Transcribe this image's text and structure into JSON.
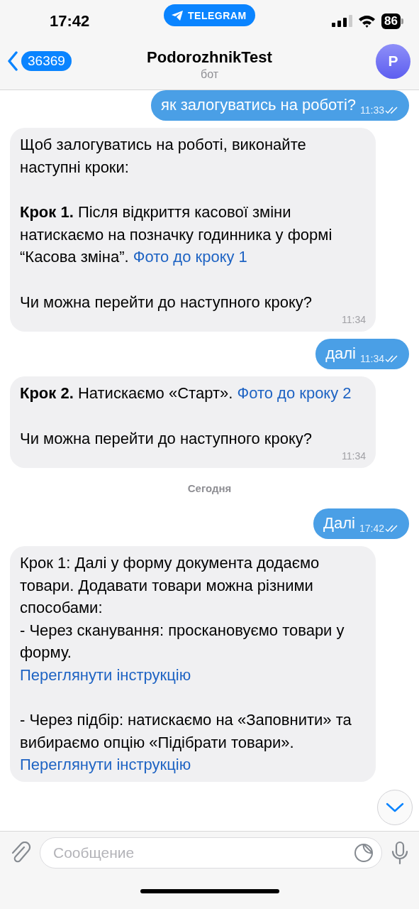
{
  "status_bar": {
    "time": "17:42",
    "app_pill": "TELEGRAM",
    "battery": "86"
  },
  "header": {
    "back_count": "36369",
    "title": "PodorozhnikTest",
    "subtitle": "бот",
    "avatar_letter": "P"
  },
  "messages": [
    {
      "kind": "outgoing",
      "text": "як залогуватись на роботі?",
      "time": "11:33",
      "read": true
    },
    {
      "kind": "incoming",
      "paragraphs": [
        {
          "text": "Щоб залогуватись на роботі, виконайте наступні кроки:"
        },
        {
          "text": "**Крок 1.** Після відкриття касової зміни натискаємо на позначку годинника у формі “Касова зміна”.",
          "link": "Фото до кроку 1"
        },
        {
          "text": "Чи можна перейти до наступного кроку?"
        }
      ],
      "time": "11:34"
    },
    {
      "kind": "outgoing",
      "text": "далі",
      "time": "11:34",
      "read": true
    },
    {
      "kind": "incoming",
      "paragraphs": [
        {
          "text": "**Крок 2.** Натискаємо «Старт».",
          "link": "Фото до кроку 2"
        },
        {
          "text": "Чи можна перейти до наступного кроку?"
        }
      ],
      "time": "11:34"
    },
    {
      "kind": "date",
      "text": "Сегодня"
    },
    {
      "kind": "outgoing",
      "text": "Далі",
      "time": "17:42",
      "read": true
    },
    {
      "kind": "incoming",
      "paragraphs": [
        {
          "text": "Крок 1: Далі у форму документа додаємо товари. Додавати товари можна різними способами:"
        },
        {
          "text": "- Через сканування: проскановуємо товари у форму.",
          "link_below": "Переглянути інструкцію"
        },
        {
          "text": "- Через підбір: натискаємо на «Заповнити» та вибираємо опцію «Підібрати товари».",
          "link_below": "Переглянути інструкцію"
        }
      ]
    }
  ],
  "composer": {
    "placeholder": "Сообщение"
  }
}
